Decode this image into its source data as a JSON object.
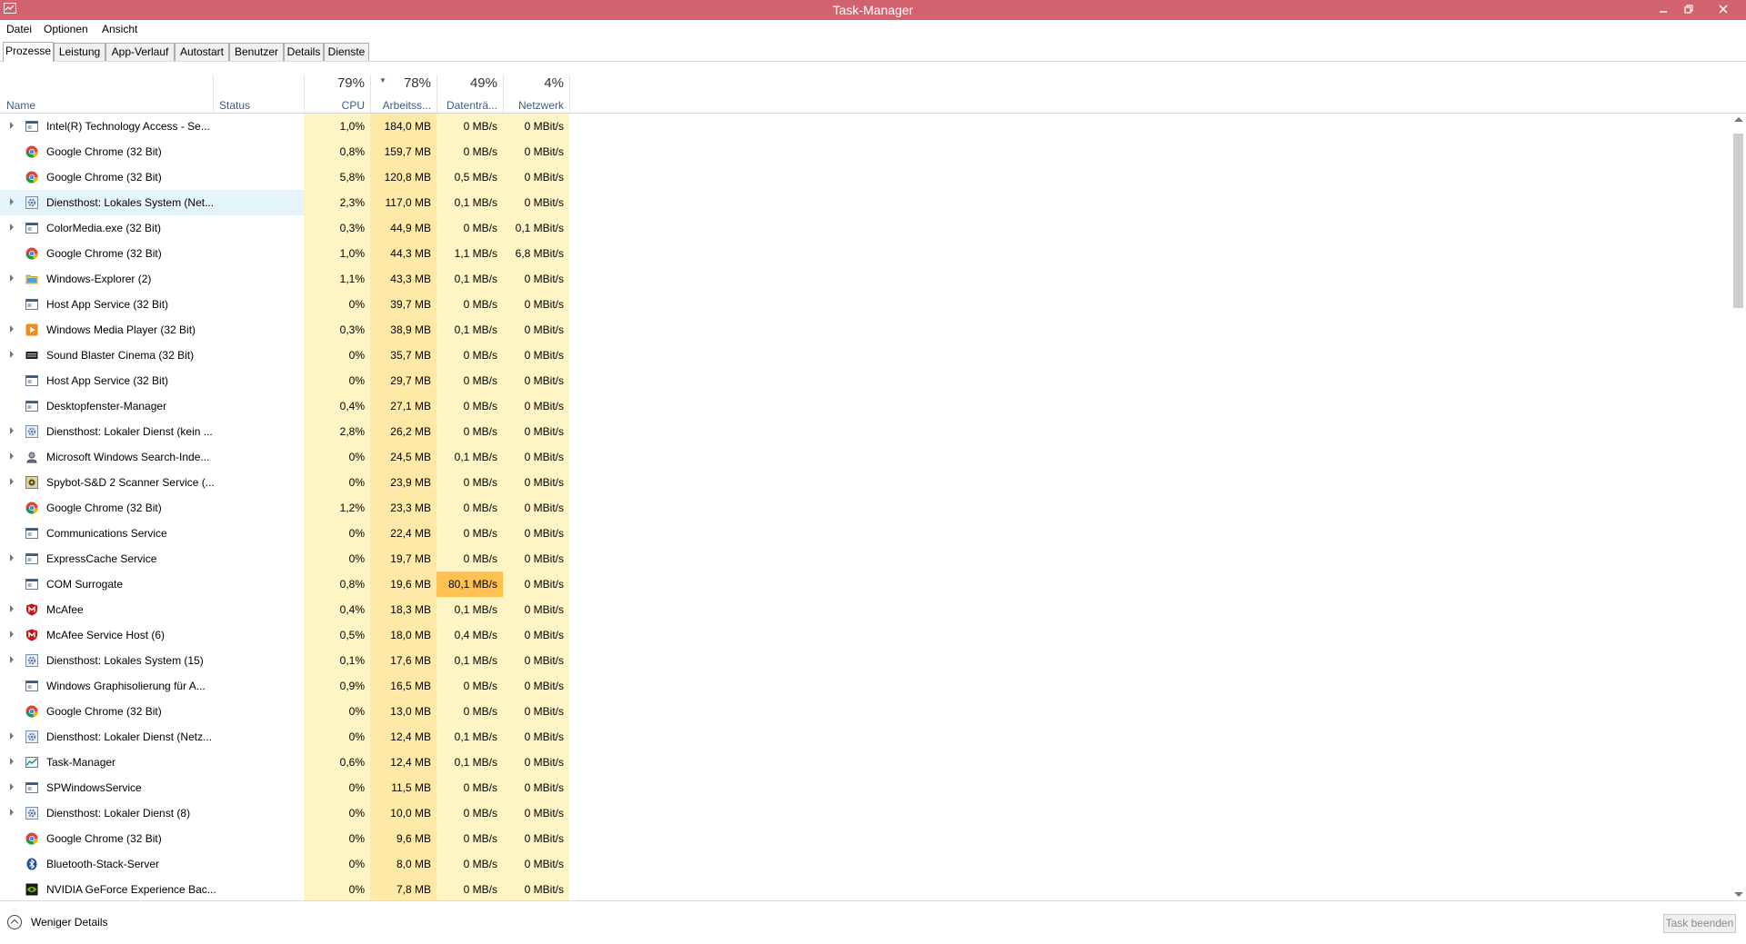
{
  "window": {
    "title": "Task-Manager"
  },
  "menu": [
    "Datei",
    "Optionen",
    "Ansicht"
  ],
  "tabs": [
    "Prozesse",
    "Leistung",
    "App-Verlauf",
    "Autostart",
    "Benutzer",
    "Details",
    "Dienste"
  ],
  "active_tab": "Prozesse",
  "columns": {
    "name": "Name",
    "status": "Status",
    "cpu": {
      "percent": "79%",
      "label": "CPU"
    },
    "memory": {
      "percent": "78%",
      "label": "Arbeitss..."
    },
    "disk": {
      "percent": "49%",
      "label": "Datenträ..."
    },
    "network": {
      "percent": "4%",
      "label": "Netzwerk"
    }
  },
  "processes": [
    {
      "name": "Intel(R) Technology Access - Se...",
      "icon": "app-window-icon",
      "expandable": true,
      "cpu": "1,0%",
      "memory": "184,0 MB",
      "disk": "0 MB/s",
      "network": "0 MBit/s"
    },
    {
      "name": "Google Chrome (32 Bit)",
      "icon": "chrome-icon",
      "expandable": false,
      "cpu": "0,8%",
      "memory": "159,7 MB",
      "disk": "0 MB/s",
      "network": "0 MBit/s"
    },
    {
      "name": "Google Chrome (32 Bit)",
      "icon": "chrome-icon",
      "expandable": false,
      "cpu": "5,8%",
      "memory": "120,8 MB",
      "disk": "0,5 MB/s",
      "network": "0 MBit/s"
    },
    {
      "name": "Diensthost: Lokales System (Net...",
      "icon": "service-gear-icon",
      "expandable": true,
      "selected": true,
      "cpu": "2,3%",
      "memory": "117,0 MB",
      "disk": "0,1 MB/s",
      "network": "0 MBit/s"
    },
    {
      "name": "ColorMedia.exe (32 Bit)",
      "icon": "app-window-icon",
      "expandable": true,
      "cpu": "0,3%",
      "memory": "44,9 MB",
      "disk": "0 MB/s",
      "network": "0,1 MBit/s"
    },
    {
      "name": "Google Chrome (32 Bit)",
      "icon": "chrome-icon",
      "expandable": false,
      "cpu": "1,0%",
      "memory": "44,3 MB",
      "disk": "1,1 MB/s",
      "network": "6,8 MBit/s"
    },
    {
      "name": "Windows-Explorer (2)",
      "icon": "folder-icon",
      "expandable": true,
      "cpu": "1,1%",
      "memory": "43,3 MB",
      "disk": "0,1 MB/s",
      "network": "0 MBit/s"
    },
    {
      "name": "Host App Service (32 Bit)",
      "icon": "app-window-icon",
      "expandable": false,
      "cpu": "0%",
      "memory": "39,7 MB",
      "disk": "0 MB/s",
      "network": "0 MBit/s"
    },
    {
      "name": "Windows Media Player (32 Bit)",
      "icon": "media-player-icon",
      "expandable": true,
      "cpu": "0,3%",
      "memory": "38,9 MB",
      "disk": "0,1 MB/s",
      "network": "0 MBit/s"
    },
    {
      "name": "Sound Blaster Cinema (32 Bit)",
      "icon": "sound-blaster-icon",
      "expandable": true,
      "cpu": "0%",
      "memory": "35,7 MB",
      "disk": "0 MB/s",
      "network": "0 MBit/s"
    },
    {
      "name": "Host App Service (32 Bit)",
      "icon": "app-window-icon",
      "expandable": false,
      "cpu": "0%",
      "memory": "29,7 MB",
      "disk": "0 MB/s",
      "network": "0 MBit/s"
    },
    {
      "name": "Desktopfenster-Manager",
      "icon": "app-window-icon",
      "expandable": false,
      "cpu": "0,4%",
      "memory": "27,1 MB",
      "disk": "0 MB/s",
      "network": "0 MBit/s"
    },
    {
      "name": "Diensthost: Lokaler Dienst (kein ...",
      "icon": "service-gear-icon",
      "expandable": true,
      "cpu": "2,8%",
      "memory": "26,2 MB",
      "disk": "0 MB/s",
      "network": "0 MBit/s"
    },
    {
      "name": "Microsoft Windows Search-Inde...",
      "icon": "search-indexer-icon",
      "expandable": true,
      "cpu": "0%",
      "memory": "24,5 MB",
      "disk": "0,1 MB/s",
      "network": "0 MBit/s"
    },
    {
      "name": "Spybot-S&D 2 Scanner Service (...",
      "icon": "spybot-icon",
      "expandable": true,
      "cpu": "0%",
      "memory": "23,9 MB",
      "disk": "0 MB/s",
      "network": "0 MBit/s"
    },
    {
      "name": "Google Chrome (32 Bit)",
      "icon": "chrome-icon",
      "expandable": false,
      "cpu": "1,2%",
      "memory": "23,3 MB",
      "disk": "0 MB/s",
      "network": "0 MBit/s"
    },
    {
      "name": "Communications Service",
      "icon": "app-window-icon",
      "expandable": false,
      "cpu": "0%",
      "memory": "22,4 MB",
      "disk": "0 MB/s",
      "network": "0 MBit/s"
    },
    {
      "name": "ExpressCache Service",
      "icon": "app-window-icon",
      "expandable": true,
      "cpu": "0%",
      "memory": "19,7 MB",
      "disk": "0 MB/s",
      "network": "0 MBit/s"
    },
    {
      "name": "COM Surrogate",
      "icon": "app-window-icon",
      "expandable": false,
      "cpu": "0,8%",
      "memory": "19,6 MB",
      "disk": "80,1 MB/s",
      "network": "0 MBit/s"
    },
    {
      "name": "McAfee",
      "icon": "mcafee-icon",
      "expandable": true,
      "cpu": "0,4%",
      "memory": "18,3 MB",
      "disk": "0,1 MB/s",
      "network": "0 MBit/s"
    },
    {
      "name": "McAfee Service Host (6)",
      "icon": "mcafee-icon",
      "expandable": true,
      "cpu": "0,5%",
      "memory": "18,0 MB",
      "disk": "0,4 MB/s",
      "network": "0 MBit/s"
    },
    {
      "name": "Diensthost: Lokales System (15)",
      "icon": "service-gear-icon",
      "expandable": true,
      "cpu": "0,1%",
      "memory": "17,6 MB",
      "disk": "0,1 MB/s",
      "network": "0 MBit/s"
    },
    {
      "name": "Windows Graphisolierung für A...",
      "icon": "app-window-icon",
      "expandable": false,
      "cpu": "0,9%",
      "memory": "16,5 MB",
      "disk": "0 MB/s",
      "network": "0 MBit/s"
    },
    {
      "name": "Google Chrome (32 Bit)",
      "icon": "chrome-icon",
      "expandable": false,
      "cpu": "0%",
      "memory": "13,0 MB",
      "disk": "0 MB/s",
      "network": "0 MBit/s"
    },
    {
      "name": "Diensthost: Lokaler Dienst (Netz...",
      "icon": "service-gear-icon",
      "expandable": true,
      "cpu": "0%",
      "memory": "12,4 MB",
      "disk": "0,1 MB/s",
      "network": "0 MBit/s"
    },
    {
      "name": "Task-Manager",
      "icon": "task-manager-icon",
      "expandable": true,
      "cpu": "0,6%",
      "memory": "12,4 MB",
      "disk": "0,1 MB/s",
      "network": "0 MBit/s"
    },
    {
      "name": "SPWindowsService",
      "icon": "app-window-icon",
      "expandable": true,
      "cpu": "0%",
      "memory": "11,5 MB",
      "disk": "0 MB/s",
      "network": "0 MBit/s"
    },
    {
      "name": "Diensthost: Lokaler Dienst (8)",
      "icon": "service-gear-icon",
      "expandable": true,
      "cpu": "0%",
      "memory": "10,0 MB",
      "disk": "0 MB/s",
      "network": "0 MBit/s"
    },
    {
      "name": "Google Chrome (32 Bit)",
      "icon": "chrome-icon",
      "expandable": false,
      "cpu": "0%",
      "memory": "9,6 MB",
      "disk": "0 MB/s",
      "network": "0 MBit/s"
    },
    {
      "name": "Bluetooth-Stack-Server",
      "icon": "bluetooth-icon",
      "expandable": false,
      "cpu": "0%",
      "memory": "8,0 MB",
      "disk": "0 MB/s",
      "network": "0 MBit/s"
    },
    {
      "name": "NVIDIA GeForce Experience Bac...",
      "icon": "nvidia-icon",
      "expandable": false,
      "cpu": "0%",
      "memory": "7,8 MB",
      "disk": "0 MB/s",
      "network": "0 MBit/s"
    }
  ],
  "footer": {
    "fewer_details": "Weniger Details",
    "end_task": "Task beenden"
  },
  "colors": {
    "titlebar": "#d1626e",
    "heat_low": "#fff4c4",
    "heat_mid": "#ffe9a7",
    "heat_high": "#ffc152",
    "selection": "#e5f3fb"
  }
}
